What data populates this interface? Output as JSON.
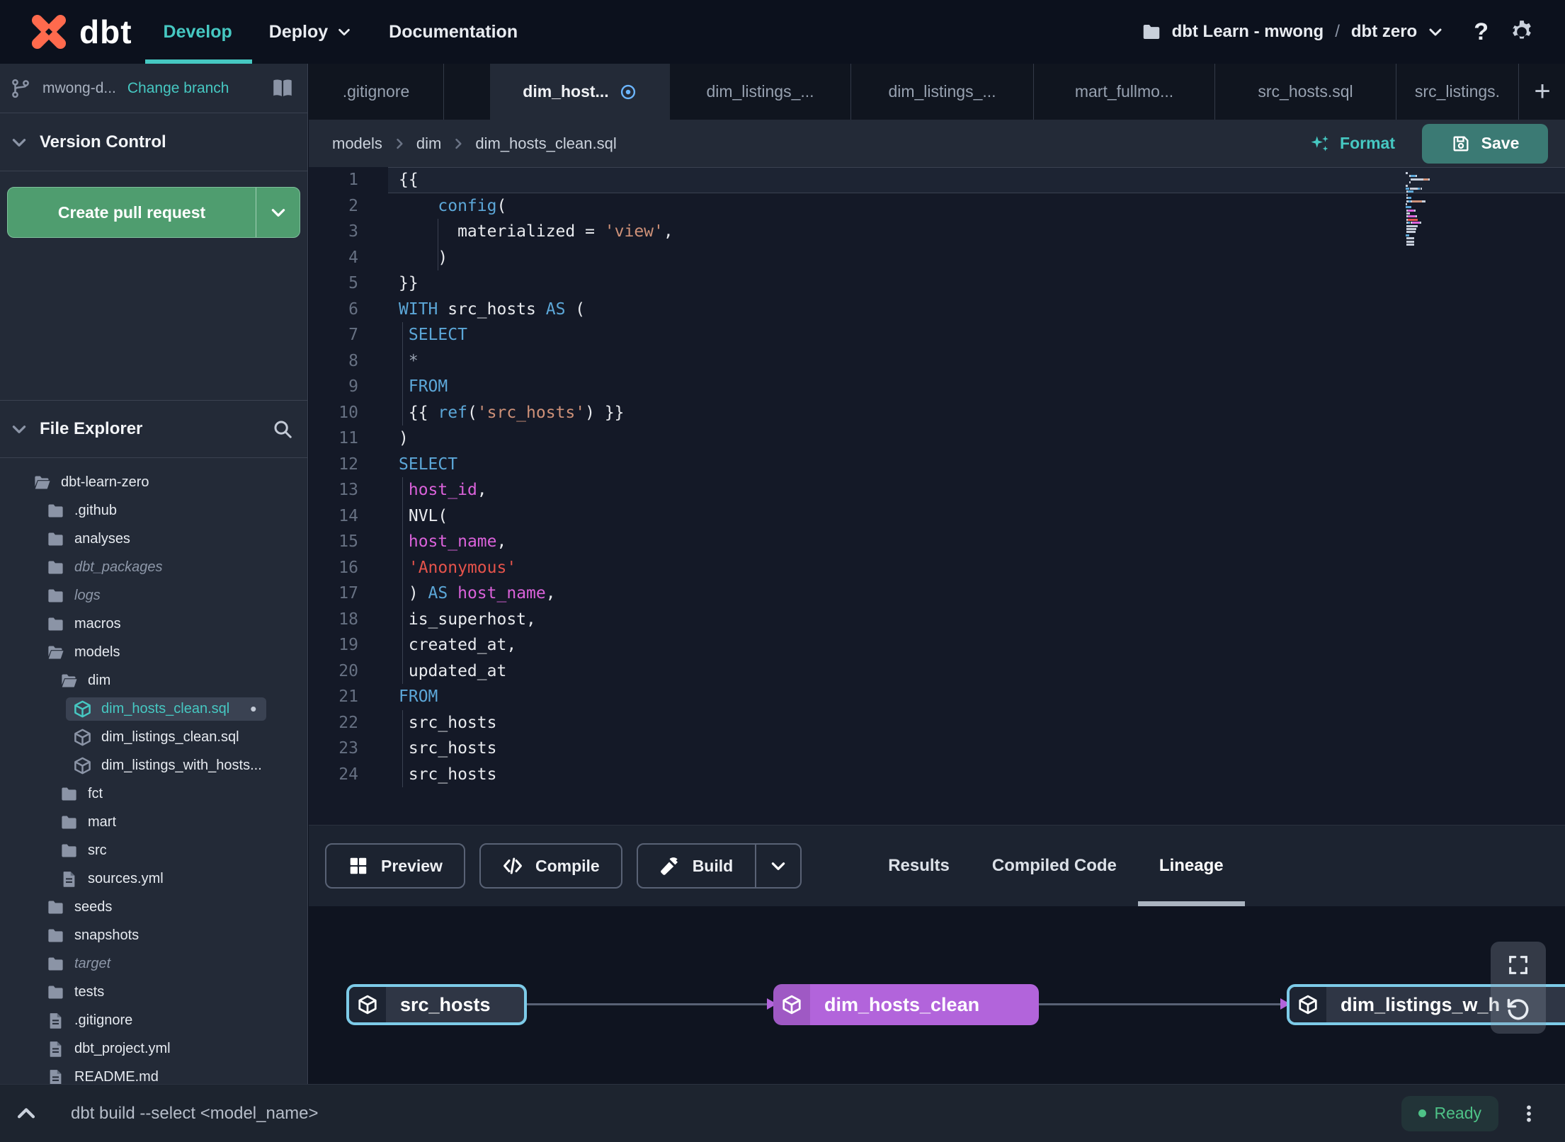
{
  "colors": {
    "accent_teal": "#46C8C2",
    "pr_button_green": "#4F9D6F",
    "save_button_teal": "#3B7A74",
    "node_source_border": "#7DCBE8",
    "node_model_purple": "#B264DB",
    "ready_green": "#4EC287",
    "modified_blue": "#6CB6FF",
    "keyword_blue": "#5CA7D8",
    "identifier_magenta": "#DA62DA",
    "string_orange": "#CE9178",
    "string_red": "#E5534B"
  },
  "topnav": {
    "brand": "dbt",
    "items": [
      {
        "label": "Develop",
        "active": true,
        "chevron": false
      },
      {
        "label": "Deploy",
        "active": false,
        "chevron": true
      },
      {
        "label": "Documentation",
        "active": false,
        "chevron": false
      }
    ],
    "project": "dbt Learn - mwong",
    "separator": "/",
    "environment": "dbt zero",
    "help": "?"
  },
  "sidebar": {
    "branch_name": "mwong-d...",
    "change_branch": "Change branch",
    "version_control_title": "Version Control",
    "create_pr_label": "Create pull request",
    "file_explorer_title": "File Explorer",
    "tree": [
      {
        "label": "dbt-learn-zero",
        "type": "folder-open",
        "depth": 0
      },
      {
        "label": ".github",
        "type": "folder",
        "depth": 1
      },
      {
        "label": "analyses",
        "type": "folder",
        "depth": 1
      },
      {
        "label": "dbt_packages",
        "type": "folder",
        "depth": 1,
        "italic": true
      },
      {
        "label": "logs",
        "type": "folder",
        "depth": 1,
        "italic": true
      },
      {
        "label": "macros",
        "type": "folder",
        "depth": 1
      },
      {
        "label": "models",
        "type": "folder-open",
        "depth": 1
      },
      {
        "label": "dim",
        "type": "folder-open",
        "depth": 2
      },
      {
        "label": "dim_hosts_clean.sql",
        "type": "model",
        "depth": 3,
        "selected": true,
        "modified": true
      },
      {
        "label": "dim_listings_clean.sql",
        "type": "model",
        "depth": 3
      },
      {
        "label": "dim_listings_with_hosts...",
        "type": "model",
        "depth": 3
      },
      {
        "label": "fct",
        "type": "folder",
        "depth": 2
      },
      {
        "label": "mart",
        "type": "folder",
        "depth": 2
      },
      {
        "label": "src",
        "type": "folder",
        "depth": 2
      },
      {
        "label": "sources.yml",
        "type": "file",
        "depth": 2
      },
      {
        "label": "seeds",
        "type": "folder",
        "depth": 1
      },
      {
        "label": "snapshots",
        "type": "folder",
        "depth": 1
      },
      {
        "label": "target",
        "type": "folder",
        "depth": 1,
        "italic": true
      },
      {
        "label": "tests",
        "type": "folder",
        "depth": 1
      },
      {
        "label": ".gitignore",
        "type": "file",
        "depth": 1
      },
      {
        "label": "dbt_project.yml",
        "type": "file",
        "depth": 1
      },
      {
        "label": "README.md",
        "type": "file",
        "depth": 1
      }
    ]
  },
  "tabs": {
    "items": [
      {
        "label": ".gitignore"
      },
      {
        "label": "dim_host...",
        "active": true,
        "modified": true
      },
      {
        "label": "dim_listings_..."
      },
      {
        "label": "dim_listings_..."
      },
      {
        "label": "mart_fullmo..."
      },
      {
        "label": "src_hosts.sql"
      },
      {
        "label": "src_listings."
      }
    ],
    "add_label": "+"
  },
  "toolbar": {
    "breadcrumb": [
      "models",
      "dim",
      "dim_hosts_clean.sql"
    ],
    "format_label": "Format",
    "save_label": "Save"
  },
  "editor": {
    "lines": [
      {
        "n": 1,
        "cur": true,
        "parts": [
          {
            "t": "{{",
            "c": "w"
          }
        ]
      },
      {
        "n": 2,
        "parts": [
          {
            "t": "    ",
            "c": "w"
          },
          {
            "t": "config",
            "c": "k"
          },
          {
            "t": "(",
            "c": "w"
          }
        ]
      },
      {
        "n": 3,
        "guide": 4,
        "parts": [
          {
            "t": "      materialized = ",
            "c": "w"
          },
          {
            "t": "'view'",
            "c": "s"
          },
          {
            "t": ",",
            "c": "w"
          }
        ]
      },
      {
        "n": 4,
        "guide": 4,
        "parts": [
          {
            "t": "    )",
            "c": "w"
          }
        ]
      },
      {
        "n": 5,
        "parts": [
          {
            "t": "}}",
            "c": "w"
          }
        ]
      },
      {
        "n": 6,
        "parts": [
          {
            "t": "WITH",
            "c": "k"
          },
          {
            "t": " src_hosts ",
            "c": "w"
          },
          {
            "t": "AS",
            "c": "k"
          },
          {
            "t": " (",
            "c": "w"
          }
        ]
      },
      {
        "n": 7,
        "guide": 0.35,
        "parts": [
          {
            "t": " ",
            "c": "w"
          },
          {
            "t": "SELECT",
            "c": "k"
          }
        ]
      },
      {
        "n": 8,
        "guide": 0.35,
        "parts": [
          {
            "t": " *",
            "c": "g"
          }
        ]
      },
      {
        "n": 9,
        "guide": 0.35,
        "parts": [
          {
            "t": " ",
            "c": "w"
          },
          {
            "t": "FROM",
            "c": "k"
          }
        ]
      },
      {
        "n": 10,
        "guide": 0.35,
        "parts": [
          {
            "t": " {{ ",
            "c": "w"
          },
          {
            "t": "ref",
            "c": "k"
          },
          {
            "t": "(",
            "c": "w"
          },
          {
            "t": "'src_hosts'",
            "c": "s"
          },
          {
            "t": ") }}",
            "c": "w"
          }
        ]
      },
      {
        "n": 11,
        "parts": [
          {
            "t": ")",
            "c": "w"
          }
        ]
      },
      {
        "n": 12,
        "parts": [
          {
            "t": "SELECT",
            "c": "k"
          }
        ]
      },
      {
        "n": 13,
        "guide": 0.35,
        "parts": [
          {
            "t": " ",
            "c": "w"
          },
          {
            "t": "host_id",
            "c": "i"
          },
          {
            "t": ",",
            "c": "w"
          }
        ]
      },
      {
        "n": 14,
        "guide": 0.35,
        "parts": [
          {
            "t": " NVL(",
            "c": "w"
          }
        ]
      },
      {
        "n": 15,
        "guide": 0.35,
        "parts": [
          {
            "t": " ",
            "c": "w"
          },
          {
            "t": "host_name",
            "c": "i"
          },
          {
            "t": ",",
            "c": "w"
          }
        ]
      },
      {
        "n": 16,
        "guide": 0.35,
        "parts": [
          {
            "t": " ",
            "c": "w"
          },
          {
            "t": "'Anonymous'",
            "c": "r"
          }
        ]
      },
      {
        "n": 17,
        "guide": 0.35,
        "parts": [
          {
            "t": " ) ",
            "c": "w"
          },
          {
            "t": "AS",
            "c": "k"
          },
          {
            "t": " ",
            "c": "w"
          },
          {
            "t": "host_name",
            "c": "i"
          },
          {
            "t": ",",
            "c": "w"
          }
        ]
      },
      {
        "n": 18,
        "guide": 0.35,
        "parts": [
          {
            "t": " is_superhost,",
            "c": "w"
          }
        ]
      },
      {
        "n": 19,
        "guide": 0.35,
        "parts": [
          {
            "t": " created_at,",
            "c": "w"
          }
        ]
      },
      {
        "n": 20,
        "guide": 0.35,
        "parts": [
          {
            "t": " updated_at",
            "c": "w"
          }
        ]
      },
      {
        "n": 21,
        "parts": [
          {
            "t": "FROM",
            "c": "k"
          }
        ]
      },
      {
        "n": 22,
        "guide": 0.35,
        "parts": [
          {
            "t": " src_hosts",
            "c": "w"
          }
        ]
      },
      {
        "n": 23,
        "guide": 0.35,
        "parts": [
          {
            "t": " src_hosts",
            "c": "w"
          }
        ]
      },
      {
        "n": 24,
        "guide": 0.35,
        "parts": [
          {
            "t": " src_hosts",
            "c": "w"
          }
        ]
      }
    ]
  },
  "panel": {
    "buttons": [
      {
        "label": "Preview",
        "icon": "grid-icon"
      },
      {
        "label": "Compile",
        "icon": "code-icon"
      },
      {
        "label": "Build",
        "icon": "hammer-icon",
        "split": true
      }
    ],
    "tabs": [
      {
        "label": "Results"
      },
      {
        "label": "Compiled Code"
      },
      {
        "label": "Lineage",
        "active": true
      }
    ]
  },
  "lineage": {
    "nodes": [
      {
        "label": "src_hosts",
        "kind": "source"
      },
      {
        "label": "dim_hosts_clean",
        "kind": "model"
      },
      {
        "label": "dim_listings_w_h",
        "kind": "source"
      }
    ]
  },
  "statusbar": {
    "command": "dbt build --select <model_name>",
    "status_label": "Ready"
  }
}
